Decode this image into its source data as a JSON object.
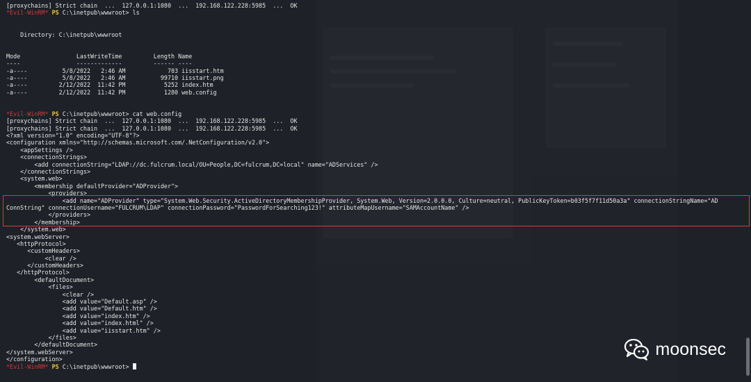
{
  "terminal": {
    "prompt_star": "*",
    "prompt_name": "Evil-WinRM*",
    "prompt_ps": "PS",
    "lines": [
      {
        "type": "text",
        "text": "[proxychains] Strict chain  ...  127.0.0.1:1080  ...  192.168.122.228:5985  ...  OK"
      },
      {
        "type": "prompt",
        "path": "C:\\inetpub\\wwwroot>",
        "cmd": "ls"
      },
      {
        "type": "text",
        "text": ""
      },
      {
        "type": "text",
        "text": ""
      },
      {
        "type": "text",
        "text": "    Directory: C:\\inetpub\\wwwroot"
      },
      {
        "type": "text",
        "text": ""
      },
      {
        "type": "text",
        "text": ""
      },
      {
        "type": "text",
        "text": "Mode                LastWriteTime         Length Name"
      },
      {
        "type": "text",
        "text": "----                -------------         ------ ----"
      },
      {
        "type": "text",
        "text": "-a----          5/8/2022   2:46 AM            703 iisstart.htm"
      },
      {
        "type": "text",
        "text": "-a----          5/8/2022   2:46 AM          99710 iisstart.png"
      },
      {
        "type": "text",
        "text": "-a----         2/12/2022  11:42 PM           5252 index.htm"
      },
      {
        "type": "text",
        "text": "-a----         2/12/2022  11:42 PM           1280 web.config"
      },
      {
        "type": "text",
        "text": ""
      },
      {
        "type": "text",
        "text": ""
      },
      {
        "type": "prompt",
        "path": "C:\\inetpub\\wwwroot>",
        "cmd": "cat web.config"
      },
      {
        "type": "text",
        "text": "[proxychains] Strict chain  ...  127.0.0.1:1080  ...  192.168.122.228:5985  ...  OK"
      },
      {
        "type": "text",
        "text": "[proxychains] Strict chain  ...  127.0.0.1:1080  ...  192.168.122.228:5985  ...  OK"
      },
      {
        "type": "text",
        "text": "<?xml version=\"1.0\" encoding=\"UTF-8\"?>"
      },
      {
        "type": "text",
        "text": "<configuration xmlns=\"http://schemas.microsoft.com/.NetConfiguration/v2.0\">"
      },
      {
        "type": "text",
        "text": "    <appSettings />"
      },
      {
        "type": "text",
        "text": "    <connectionStrings>"
      },
      {
        "type": "text",
        "text": "        <add connectionString=\"LDAP://dc.fulcrum.local/OU=People,DC=fulcrum,DC=local\" name=\"ADServices\" />"
      },
      {
        "type": "text",
        "text": "    </connectionStrings>"
      },
      {
        "type": "text",
        "text": "    <system.web>"
      },
      {
        "type": "text",
        "text": "        <membership defaultProvider=\"ADProvider\">"
      },
      {
        "type": "text",
        "text": "            <providers>"
      },
      {
        "type": "text",
        "text": "                <add name=\"ADProvider\" type=\"System.Web.Security.ActiveDirectoryMembershipProvider, System.Web, Version=2.0.0.0, Culture=neutral, PublicKeyToken=b03f5f7f11d50a3a\" connectionStringName=\"AD"
      },
      {
        "type": "text",
        "text": "ConnString\" connectionUsername=\"FULCRUM\\LDAP\" connectionPassword=\"PasswordForSearching123!\" attributeMapUsername=\"SAMAccountName\" />"
      },
      {
        "type": "text",
        "text": "            </providers>"
      },
      {
        "type": "text",
        "text": "        </membership>"
      },
      {
        "type": "text",
        "text": "    </system.web>"
      },
      {
        "type": "text",
        "text": "<system.webServer>"
      },
      {
        "type": "text",
        "text": "   <httpProtocol>"
      },
      {
        "type": "text",
        "text": "      <customHeaders>"
      },
      {
        "type": "text",
        "text": "           <clear />"
      },
      {
        "type": "text",
        "text": "      </customHeaders>"
      },
      {
        "type": "text",
        "text": "   </httpProtocol>"
      },
      {
        "type": "text",
        "text": "        <defaultDocument>"
      },
      {
        "type": "text",
        "text": "            <files>"
      },
      {
        "type": "text",
        "text": "                <clear />"
      },
      {
        "type": "text",
        "text": "                <add value=\"Default.asp\" />"
      },
      {
        "type": "text",
        "text": "                <add value=\"Default.htm\" />"
      },
      {
        "type": "text",
        "text": "                <add value=\"index.htm\" />"
      },
      {
        "type": "text",
        "text": "                <add value=\"index.html\" />"
      },
      {
        "type": "text",
        "text": "                <add value=\"iisstart.htm\" />"
      },
      {
        "type": "text",
        "text": "            </files>"
      },
      {
        "type": "text",
        "text": "        </defaultDocument>"
      },
      {
        "type": "text",
        "text": "</system.webServer>"
      },
      {
        "type": "text",
        "text": "</configuration>"
      },
      {
        "type": "prompt",
        "path": "C:\\inetpub\\wwwroot>",
        "cmd": "",
        "cursor": true
      }
    ]
  },
  "highlight": {
    "color": "#d83a3a"
  },
  "watermark": {
    "text": "moonsec",
    "icon": "wechat-icon"
  },
  "colors": {
    "background": "#1e2127",
    "text": "#e6e6e6",
    "prompt_red": "#d03a3a",
    "prompt_yellow": "#e8c546"
  }
}
